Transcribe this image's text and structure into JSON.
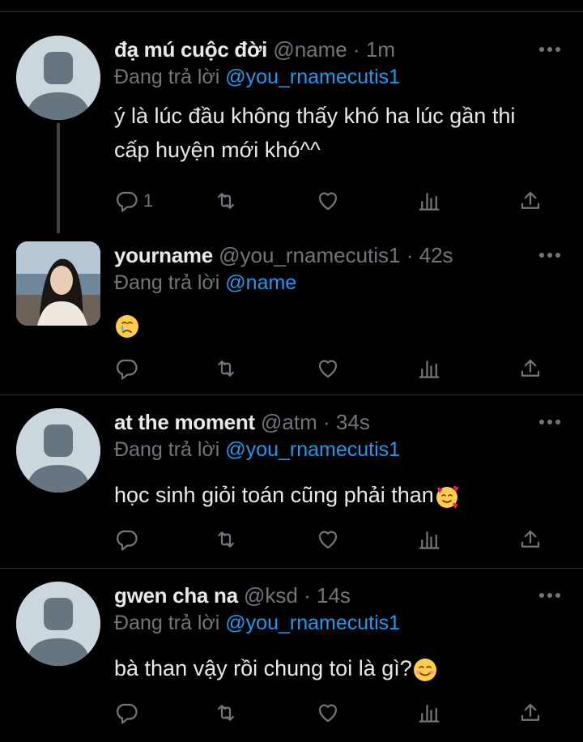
{
  "reply_prefix": "Đang trả lời",
  "colors": {
    "background": "#000000",
    "text": "#e7e9ea",
    "muted": "#71767b",
    "mention": "#1d9bf0",
    "divider": "#2f3336"
  },
  "tweets": [
    {
      "name": "đạ mú cuộc đời",
      "handle": "@name",
      "dot": "·",
      "time": "1m",
      "reply_to": "@you_rnamecutis1",
      "text_lines": [
        "ý là lúc đầu không thấy khó ha lúc gần thi",
        "cấp huyện mới khó^^"
      ],
      "reply_count": "1",
      "avatar": "default-avatar"
    },
    {
      "name": "yourname",
      "handle": "@you_rnamecutis1",
      "dot": "·",
      "time": "42s",
      "reply_to": "@name",
      "text": "",
      "emoji": "holding-back-tears-emoji",
      "avatar": "photo-avatar"
    },
    {
      "name": "at the moment",
      "handle": "@atm",
      "dot": "·",
      "time": "34s",
      "reply_to": "@you_rnamecutis1",
      "text": "học sinh giỏi toán cũng phải than",
      "emoji": "smiling-face-with-hearts-emoji",
      "avatar": "default-avatar"
    },
    {
      "name": "gwen cha na",
      "handle": "@ksd",
      "dot": "·",
      "time": "14s",
      "reply_to": "@you_rnamecutis1",
      "text": "bà than vậy rồi chung toi là gì?",
      "emoji": "smiling-face-emoji",
      "avatar": "default-avatar"
    }
  ]
}
